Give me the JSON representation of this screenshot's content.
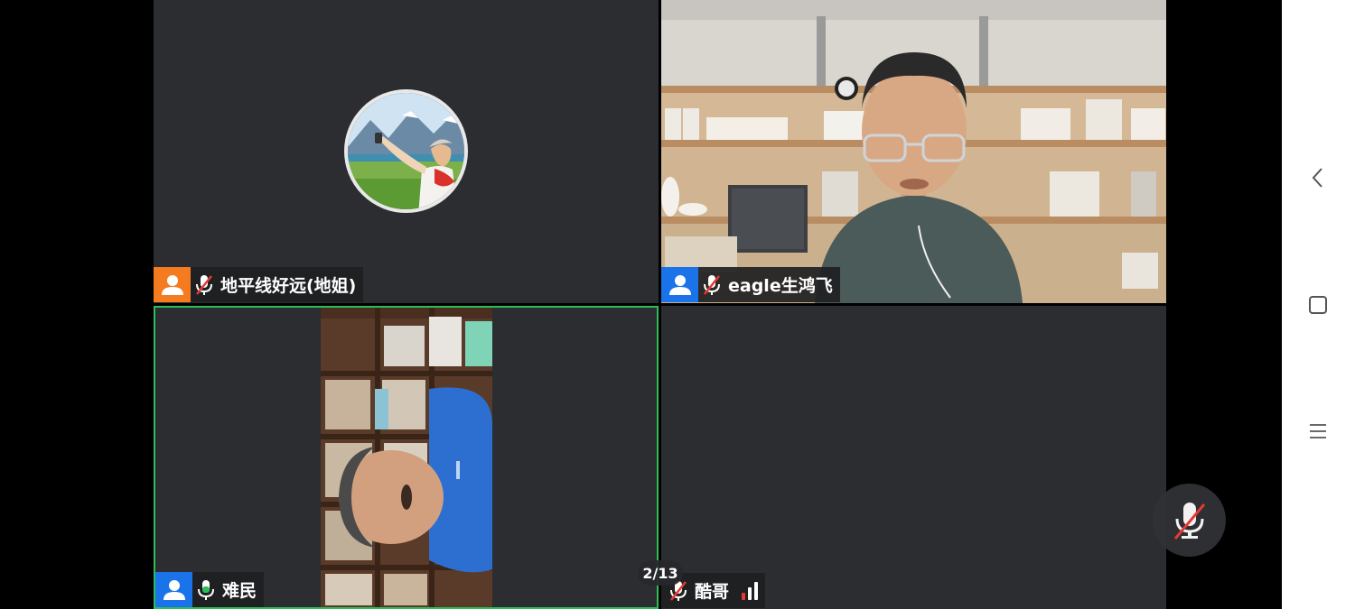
{
  "participants": [
    {
      "name": "地平线好远(地姐)",
      "role_color": "#f47b20",
      "mic": "muted"
    },
    {
      "name": "eagle生鸿飞",
      "role_color": "#1a73e8",
      "mic": "muted"
    },
    {
      "name": "难民",
      "role_color": "#1a73e8",
      "mic": "active",
      "speaking": true
    },
    {
      "name": "酷哥",
      "mic": "muted",
      "signal": "good"
    }
  ],
  "pager": {
    "label": "2/13"
  },
  "controls": {
    "mute_button": "mic-muted-icon"
  },
  "colors": {
    "active_speaker_border": "#2ebd59",
    "tile_bg": "#2b2d30",
    "mute_red": "#e53935",
    "mic_green": "#2ebd59"
  },
  "system_nav": {
    "back": "chevron-left-icon",
    "home": "square-icon",
    "menu": "hamburger-icon"
  }
}
